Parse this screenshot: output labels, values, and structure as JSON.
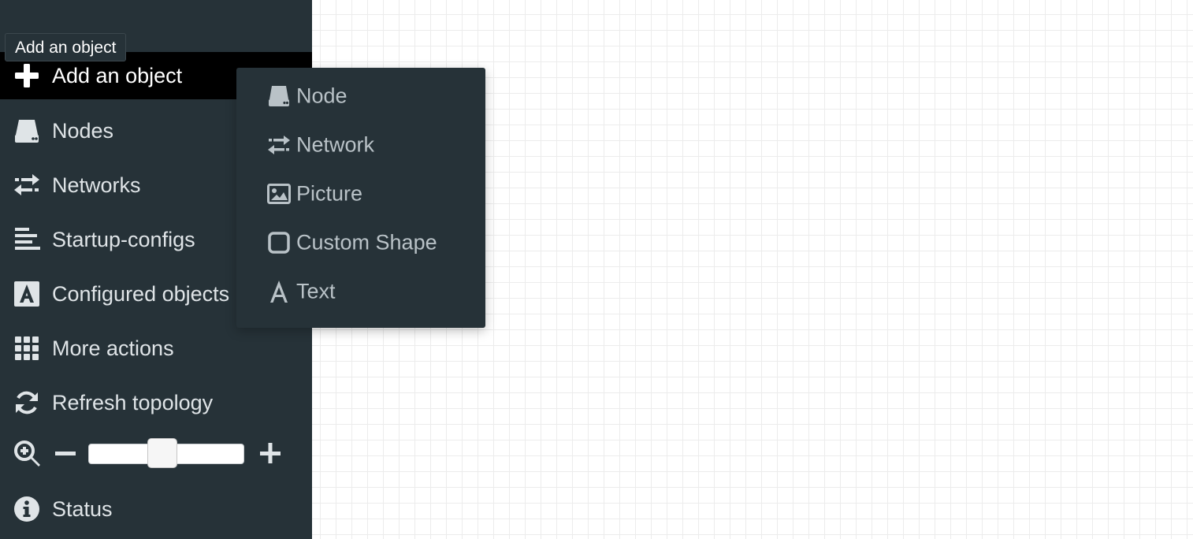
{
  "tooltip": {
    "text": "Add an object"
  },
  "sidebar": {
    "items": [
      {
        "label": "Add an object",
        "icon": "plus-icon"
      },
      {
        "label": "Nodes",
        "icon": "hdd-icon"
      },
      {
        "label": "Networks",
        "icon": "exchange-icon"
      },
      {
        "label": "Startup-configs",
        "icon": "align-left-icon"
      },
      {
        "label": "Configured objects",
        "icon": "font-a-icon"
      },
      {
        "label": "More actions",
        "icon": "grid-icon"
      },
      {
        "label": "Refresh topology",
        "icon": "refresh-icon"
      },
      {
        "label": "Status",
        "icon": "info-icon"
      }
    ],
    "zoom": {
      "icon": "zoom-in-icon",
      "minus_icon": "minus-icon",
      "plus_icon": "plus-icon",
      "level": 0.47
    }
  },
  "add_menu": {
    "items": [
      {
        "label": "Node",
        "icon": "hdd-icon"
      },
      {
        "label": "Network",
        "icon": "exchange-icon"
      },
      {
        "label": "Picture",
        "icon": "image-icon"
      },
      {
        "label": "Custom Shape",
        "icon": "square-outline-icon"
      },
      {
        "label": "Text",
        "icon": "text-a-icon"
      }
    ]
  },
  "colors": {
    "sidebar_bg": "#263238",
    "active_bg": "#000000",
    "menu_text": "#b9c2c7",
    "sidebar_text": "#dfe4e7",
    "grid_line": "#ececec"
  }
}
